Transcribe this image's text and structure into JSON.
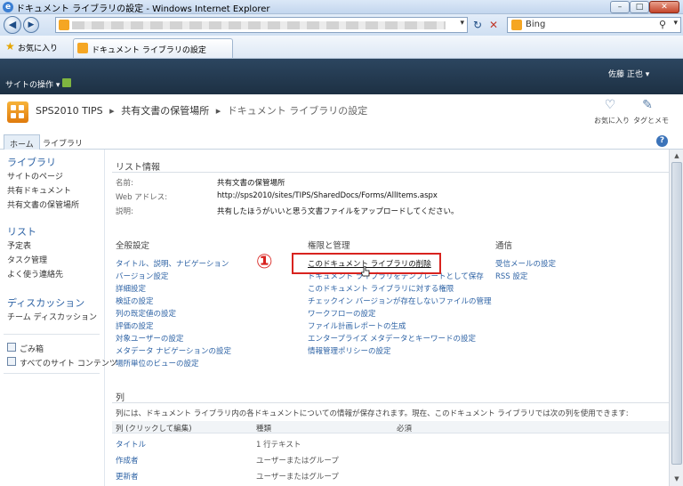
{
  "window": {
    "title": "ドキュメント ライブラリの設定 - Windows Internet Explorer",
    "min": "–",
    "max": "□",
    "close": "✕"
  },
  "browser": {
    "back": "◀",
    "fwd": "▶",
    "refresh": "↻",
    "stop": "✕",
    "search_provider": "Bing",
    "search_icon": "⚲",
    "favorites_label": "お気に入り",
    "tab_title": "ドキュメント ライブラリの設定"
  },
  "sp": {
    "site_actions": "サイトの操作 ▾",
    "user": "佐藤 正也 ▾"
  },
  "header": {
    "breadcrumb": [
      "SPS2010 TIPS",
      "共有文書の保管場所",
      "ドキュメント ライブラリの設定"
    ],
    "sep": "▸",
    "like_label": "お気に入り",
    "tag_label": "タグとメモ"
  },
  "tabs": [
    "ホーム",
    "ライブラリ"
  ],
  "help": "?",
  "leftnav": {
    "libraries_head": "ライブラリ",
    "libraries": [
      "サイトのページ",
      "共有ドキュメント",
      "共有文書の保管場所"
    ],
    "lists_head": "リスト",
    "lists": [
      "予定表",
      "タスク管理",
      "よく使う連絡先"
    ],
    "discussions_head": "ディスカッション",
    "discussions": [
      "チーム ディスカッション"
    ],
    "recycle": "ごみ箱",
    "all_content": "すべてのサイト コンテンツ"
  },
  "listinfo": {
    "title": "リスト情報",
    "name_label": "名前:",
    "name_value": "共有文書の保管場所",
    "web_label": "Web アドレス:",
    "web_value": "http://sps2010/sites/TIPS/SharedDocs/Forms/AllItems.aspx",
    "desc_label": "説明:",
    "desc_value": "共有したほうがいいと思う文書ファイルをアップロードしてください。"
  },
  "general": {
    "title": "全般設定",
    "links": [
      "タイトル、説明、ナビゲーション",
      "バージョン設定",
      "詳細設定",
      "検証の設定",
      "列の既定値の設定",
      "評価の設定",
      "対象ユーザーの設定",
      "メタデータ ナビゲーションの設定",
      "場所単位のビューの設定"
    ]
  },
  "permissions": {
    "title": "権限と管理",
    "links": [
      "このドキュメント ライブラリの削除",
      "ドキュメント ライブラリをテンプレートとして保存",
      "このドキュメント ライブラリに対する権限",
      "チェックイン バージョンが存在しないファイルの管理",
      "ワークフローの設定",
      "ファイル計画レポートの生成",
      "エンタープライズ メタデータとキーワードの設定",
      "情報管理ポリシーの設定"
    ]
  },
  "communication": {
    "title": "通信",
    "links": [
      "受信メールの設定",
      "RSS 設定"
    ]
  },
  "annotation": "①",
  "columns": {
    "title": "列",
    "description": "列には、ドキュメント ライブラリ内の各ドキュメントについての情報が保存されます。現在、このドキュメント ライブラリでは次の列を使用できます:",
    "headers": [
      "列 (クリックして編集)",
      "種類",
      "必須"
    ],
    "rows": [
      {
        "name": "タイトル",
        "type": "1 行テキスト"
      },
      {
        "name": "作成者",
        "type": "ユーザーまたはグループ"
      },
      {
        "name": "更新者",
        "type": "ユーザーまたはグループ"
      }
    ]
  }
}
